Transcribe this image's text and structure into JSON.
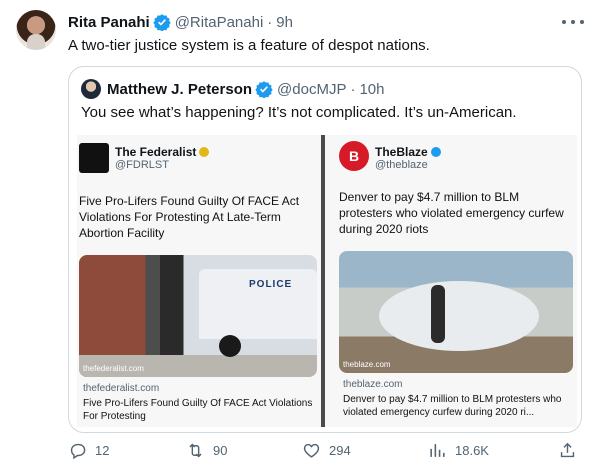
{
  "author": {
    "name": "Rita Panahi",
    "handle": "@RitaPanahi",
    "time": "9h"
  },
  "tweet_text": "A two-tier justice system is a feature of despot nations.",
  "quoted": {
    "name": "Matthew J. Peterson",
    "handle": "@docMJP",
    "time": "10h",
    "text": "You see what’s happening? It’s not complicated. It’s un-American.",
    "left_panel": {
      "source_name": "The Federalist",
      "source_handle": "@FDRLST",
      "headline": "Five Pro-Lifers Found Guilty Of FACE Act Violations For Protesting At Late-Term Abortion Facility",
      "photo_label": "POLICE",
      "photo_credit": "thefederalist.com",
      "card_domain": "thefederalist.com",
      "card_title": "Five Pro-Lifers Found Guilty Of FACE Act Violations For Protesting"
    },
    "right_panel": {
      "source_name": "TheBlaze",
      "source_handle": "@theblaze",
      "headline": "Denver to pay $4.7 million to BLM protesters who violated emergency curfew during 2020 riots",
      "photo_credit": "theblaze.com",
      "card_domain": "theblaze.com",
      "card_title": "Denver to pay $4.7 million to BLM protesters who violated emergency curfew during 2020 ri..."
    }
  },
  "actions": {
    "replies": "12",
    "reposts": "90",
    "likes": "294",
    "views": "18.6K"
  },
  "colors": {
    "verified": "#1d9bf0",
    "secondary_text": "#536471",
    "border": "#cfd9de",
    "blaze_red": "#d71a28"
  }
}
